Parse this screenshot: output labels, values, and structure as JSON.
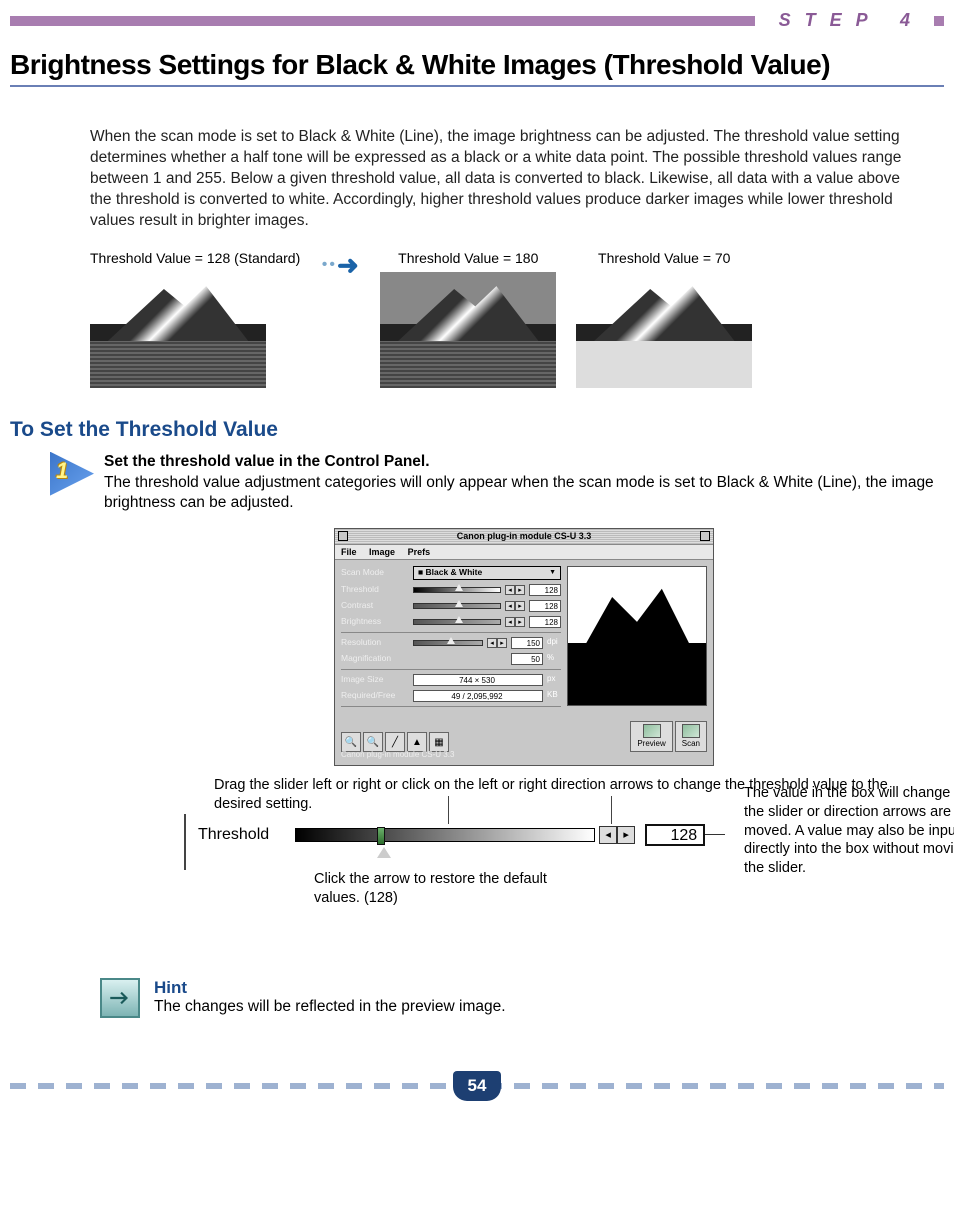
{
  "header": {
    "step_label": "STEP 4"
  },
  "title": "Brightness Settings for Black & White Images (Threshold Value)",
  "intro": "When the scan mode is set to Black & White (Line), the image brightness can be adjusted. The threshold value setting determines whether a half tone will be expressed as a black or a white data point. The possible threshold values range between 1 and 255. Below a given threshold value, all data is converted to black. Likewise, all data with a value above the threshold is converted to white. Accordingly, higher threshold values produce darker images while lower threshold values result in brighter images.",
  "examples": [
    {
      "caption": "Threshold Value = 128 (Standard)"
    },
    {
      "caption": "Threshold Value = 180"
    },
    {
      "caption": "Threshold Value = 70"
    }
  ],
  "section_heading": "To Set the Threshold Value",
  "step1": {
    "number": "1",
    "bold": "Set the threshold value in the Control Panel.",
    "text": "The threshold value adjustment categories will only appear when the scan mode is set to Black & White (Line), the image brightness can be adjusted."
  },
  "panel": {
    "window_title": "Canon plug-in module CS-U 3.3",
    "menus": {
      "file": "File",
      "image": "Image",
      "prefs": "Prefs"
    },
    "rows": {
      "scan_mode": {
        "label": "Scan Mode",
        "value": "Black & White"
      },
      "threshold": {
        "label": "Threshold",
        "value": "128"
      },
      "contrast": {
        "label": "Contrast",
        "value": "128"
      },
      "brightness": {
        "label": "Brightness",
        "value": "128"
      },
      "resolution": {
        "label": "Resolution",
        "value": "150",
        "unit": "dpi"
      },
      "magnification": {
        "label": "Magnification",
        "value": "50",
        "unit": "%"
      },
      "image_size": {
        "label": "Image Size",
        "value": "744 × 530",
        "unit": "px"
      },
      "required_free": {
        "label": "Required/Free",
        "value": "49 / 2,095,992",
        "unit": "KB"
      }
    },
    "buttons": {
      "preview": "Preview",
      "scan": "Scan"
    },
    "status": "Canon plug-in module CS-U 3.3"
  },
  "annotations": {
    "slider_instruction": "Drag the slider left or right or click on the left or right direction arrows to change the threshold value to the desired setting.",
    "reset_instruction": "Click the arrow to restore the default values. (128)",
    "value_box_note": "The value in the box will change as the slider or direction arrows are moved. A value may also be input directly into the box without moving the slider."
  },
  "threshold_control": {
    "label": "Threshold",
    "value": "128"
  },
  "hint": {
    "title": "Hint",
    "text": "The changes will be reflected in the preview image."
  },
  "page_number": "54"
}
